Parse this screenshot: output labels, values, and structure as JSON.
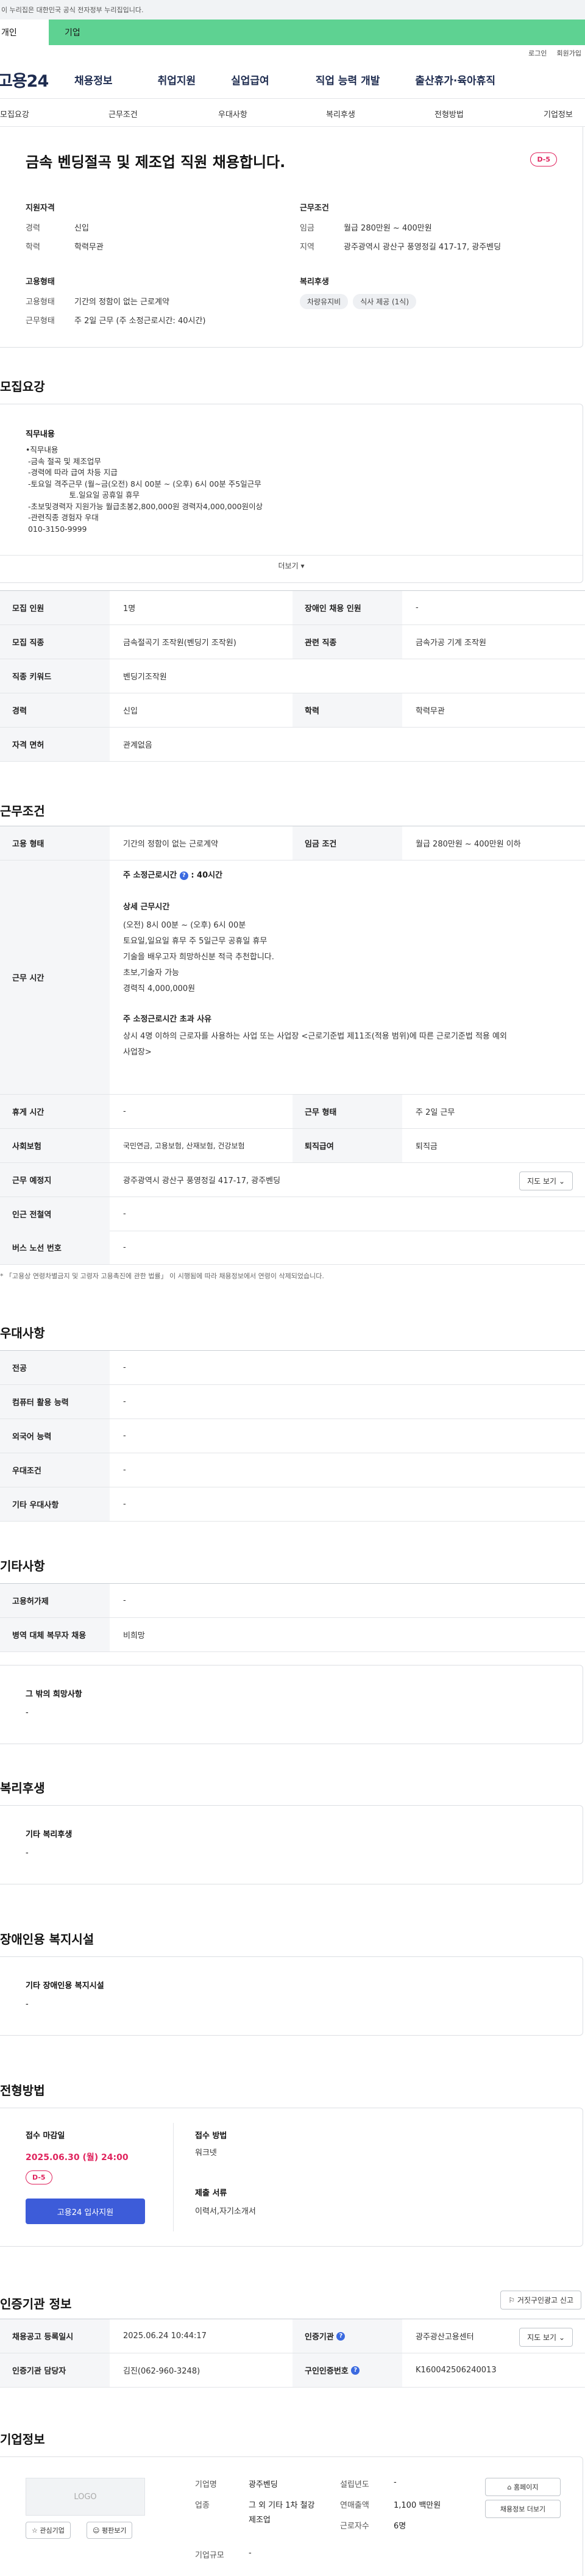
{
  "gov_banner": "이 누리집은 대한민국 공식 전자정부 누리집입니다.",
  "top_tabs": {
    "personal": "개인",
    "corporate": "기업"
  },
  "util_links": [
    "로그인",
    "회원가입"
  ],
  "logo": "고용24",
  "gnb": [
    "채용정보",
    "취업지원",
    "실업급여",
    "직업 능력 개발",
    "출산휴가·육아휴직"
  ],
  "subnav": [
    "모집요강",
    "근무조건",
    "우대사항",
    "복리후생",
    "전형방법",
    "기업정보"
  ],
  "job": {
    "title": "금속 벤딩절곡 및 제조업 직원 채용합니다.",
    "dday": "D-5",
    "qual_title": "지원자격",
    "qual": [
      {
        "k": "경력",
        "v": "신입"
      },
      {
        "k": "학력",
        "v": "학력무관"
      }
    ],
    "type_title": "고용형태",
    "type": [
      {
        "k": "고용형태",
        "v": "기간의 정함이 없는 근로계약"
      },
      {
        "k": "근무형태",
        "v": "주 2일 근무 (주 소정근로시간: 40시간)"
      }
    ],
    "cond_title": "근무조건",
    "cond": [
      {
        "k": "임금",
        "v": "월급 280만원 ~ 400만원"
      },
      {
        "k": "지역",
        "v": "광주광역시 광산구 풍영정길 417-17, 광주벤딩"
      }
    ],
    "welfare_title": "복리후생",
    "welfare_chips": [
      "차량유지비",
      "식사 제공 (1식)"
    ]
  },
  "recruit": {
    "title": "모집요강",
    "duty_title": "직무내용",
    "duty_lines": [
      "•직무내용",
      " -금속 절곡 및 제조업무",
      " -경력에 따라 급여 차등 지급",
      " -토요일 격주근무 (월~금(오전) 8시 00분 ~ (오후) 6시 00분 주5일근무",
      "                  토.일요일 공휴일 휴무",
      " -초보및경력자 지원가능 월급초봉2,800,000원 경력자4,000,000원이상",
      " -관련직종 경험자 우대",
      " 010-3150-9999"
    ],
    "more": "더보기",
    "rows": [
      {
        "k1": "모집 인원",
        "v1": "1명",
        "k2": "장애인 채용 인원",
        "v2": "-"
      },
      {
        "k1": "모집 직종",
        "v1": "금속절곡기 조작원(벤딩기 조작원)",
        "k2": "관련 직종",
        "v2": "금속가공 기계 조작원"
      },
      {
        "k1": "직종 키워드",
        "v1": "벤딩기조작원"
      },
      {
        "k1": "경력",
        "v1": "신입",
        "k2": "학력",
        "v2": "학력무관"
      },
      {
        "k1": "자격 면허",
        "v1": "관계없음"
      }
    ]
  },
  "work": {
    "title": "근무조건",
    "r1": {
      "k1": "고용 형태",
      "v1": "기간의 정함이 없는 근로계약",
      "k2": "임금 조건",
      "v2": "월급 280만원 ~ 400만원 이하"
    },
    "hours_label": "근무 시간",
    "hours_main": "주 소정근로시간",
    "hours_main_val": ": 40시간",
    "detail_title": "상세 근무시간",
    "detail_lines": [
      "(오전) 8시 00분 ~ (오후) 6시 00분",
      "토요일,일요일 휴무 주 5일근무 공휴일 휴무",
      "기술을 배우고자 희망하신분 적극 추천합니다.",
      "초보,기술자 가능",
      "경력직 4,000,000원"
    ],
    "exceed_title": "주 소정근로시간 초과 사유",
    "exceed_lines": [
      "상시 4명 이하의 근로자를 사용하는 사업 또는 사업장 <근로기준법 제11조(적용 범위)에 따른 근로기준법 적용 예외",
      "사업장>"
    ],
    "rows": [
      {
        "k1": "휴게 시간",
        "v1": "-",
        "k2": "근무 형태",
        "v2": "주 2일 근무"
      },
      {
        "k1": "사회보험",
        "v1": "국민연금, 고용보험, 산재보험, 건강보험",
        "k2": "퇴직급여",
        "v2": "퇴직금"
      },
      {
        "k1": "근무 예정지",
        "v1": "광주광역시 광산구 풍영정길 417-17, 광주벤딩"
      },
      {
        "k1": "인근 전철역",
        "v1": "-"
      },
      {
        "k1": "버스 노선 번호",
        "v1": "-"
      }
    ],
    "map_btn": "지도 보기",
    "note": "* 「고용상 연령차별금지 및 고령자 고용촉진에 관한 법률」 이 시행됨에 따라 채용정보에서 연령이 삭제되었습니다."
  },
  "prefer": {
    "title": "우대사항",
    "rows": [
      {
        "k": "전공",
        "v": "-"
      },
      {
        "k": "컴퓨터 활용 능력",
        "v": "-"
      },
      {
        "k": "외국어 능력",
        "v": "-"
      },
      {
        "k": "우대조건",
        "v": "-"
      },
      {
        "k": "기타 우대사항",
        "v": "-"
      }
    ]
  },
  "etc": {
    "title": "기타사항",
    "rows": [
      {
        "k": "고용허가제",
        "v": "-"
      },
      {
        "k": "병역 대체 복무자 채용",
        "v": "비희망"
      }
    ],
    "box_title": "그 밖의 희망사항",
    "box_val": "-"
  },
  "benefit": {
    "title": "복리후생",
    "box_title": "기타 복리후생",
    "box_val": "-"
  },
  "disabled": {
    "title": "장애인용 복지시설",
    "box_title": "기타 장애인용 복지시설",
    "box_val": "-"
  },
  "apply": {
    "title": "전형방법",
    "deadline_label": "접수 마감일",
    "deadline": "2025.06.30 (월) 24:00",
    "dday": "D-5",
    "apply_btn": "고용24 입사지원",
    "method_label": "접수 방법",
    "method": "워크넷",
    "docs_label": "제출 서류",
    "docs": "이력서,자기소개서"
  },
  "cert": {
    "title": "인증기관 정보",
    "report_btn": "거짓구인광고 신고",
    "rows": [
      {
        "k1": "채용공고 등록일시",
        "v1": "2025.06.24 10:44:17",
        "k2": "인증기관",
        "v2": "광주광산고용센터"
      },
      {
        "k1": "인증기관 담당자",
        "v1": "김진(062-960-3248)",
        "k2": "구인인증번호",
        "v2": "K160042506240013"
      }
    ],
    "map_btn": "지도 보기"
  },
  "company": {
    "title": "기업정보",
    "logo_text": "LOGO",
    "fav_btn": "관심기업",
    "rating_btn": "평판보기",
    "rows": [
      {
        "k": "기업명",
        "v": "광주벤딩"
      },
      {
        "k": "업종",
        "v": "그 외 기타 1차 철강 제조업"
      },
      {
        "k": "기업규모",
        "v": "-"
      }
    ],
    "rows2": [
      {
        "k": "설립년도",
        "v": "-"
      },
      {
        "k": "연매출액",
        "v": "1,100 백만원"
      },
      {
        "k": "근로자수",
        "v": "6명"
      }
    ],
    "home_btn": "홈페이지",
    "jobs_btn": "채용정보 더보기"
  }
}
